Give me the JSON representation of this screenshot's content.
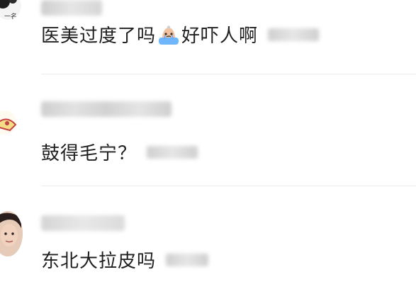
{
  "comments": [
    {
      "text_before_emoji": "医美过度了吗",
      "emoji": "crying-face-emoji",
      "text_after_emoji": "好吓人啊"
    },
    {
      "text": "鼓得毛宁？"
    },
    {
      "text": "东北大拉皮吗"
    }
  ]
}
